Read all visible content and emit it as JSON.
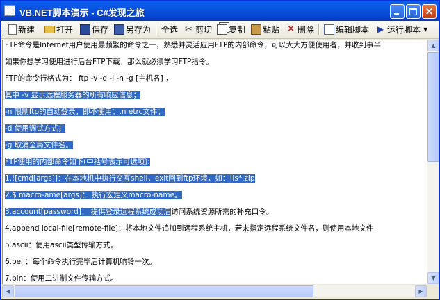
{
  "window": {
    "title": "VB.NET脚本演示 - C#发现之旅",
    "buttons": {
      "minimize": "minimize",
      "maximize": "maximize",
      "close": "×"
    }
  },
  "toolbar": {
    "new_label": "新建",
    "open_label": "打开",
    "save_label": "保存",
    "saveas_label": "另存为",
    "selectall_label": "全选",
    "cut_label": "剪切",
    "copy_label": "复制",
    "paste_label": "粘贴",
    "delete_label": "删除",
    "editscript_label": "编辑脚本",
    "run_label": "运行脚本"
  },
  "editor": {
    "lines": [
      {
        "text": "FTP命令是Internet用户使用最频繁的命令之一，熟悉并灵活应用FTP的内部命令，可以大大方便使用者，并收到事半",
        "selected": false
      },
      {
        "text": "如果你想学习使用进行后台FTP下载，那么就必须学习FTP指令。",
        "selected": false
      },
      {
        "text": "FTP的命令行格式为： ftp -v -d -i -n -g [主机名] ，",
        "selected": false
      },
      {
        "text": "其中 -v 显示远程服务器的所有响应信息；",
        "selected": true
      },
      {
        "text": "-n 限制ftp的自动登录，即不使用；.n etrc文件；",
        "selected": true
      },
      {
        "text": "-d 使用调试方式；",
        "selected": true
      },
      {
        "text": "-g 取消全局文件名。",
        "selected": true
      },
      {
        "text": "FTP使用的内部命令如下(中括号表示可选项):",
        "selected": true
      },
      {
        "text": "1.![cmd[args]]：在本地机中执行交互shell，exit回到ftp环境，如：!ls*.zip",
        "selected": true
      },
      {
        "text": "2.$ macro-ame[args]： 执行宏定义macro-name。",
        "selected": true
      },
      {
        "text": "3.account[password]： 提供登录远程系统成功后",
        "selected": true,
        "rest": "访问系统资源所需的补充口令。"
      },
      {
        "text": "4.append local-file[remote-file]：将本地文件追加到远程系统主机，若未指定远程系统文件名，则使用本地文件",
        "selected": false
      },
      {
        "text": "5.ascii：使用ascii类型传输方式。",
        "selected": false
      },
      {
        "text": "6.bell：每个命令执行完毕后计算机响铃一次。",
        "selected": false
      },
      {
        "text": "7.bin：使用二进制文件传输方式。",
        "selected": false
      }
    ]
  },
  "scrollbar": {
    "up": "▲",
    "down": "▼",
    "left": "◀",
    "right": "▶"
  }
}
